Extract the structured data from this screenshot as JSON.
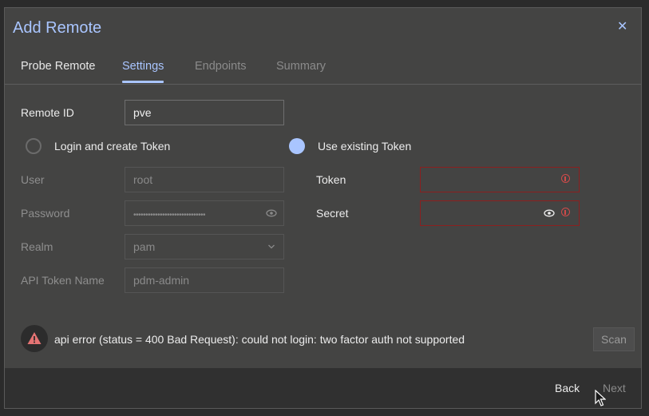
{
  "dialog": {
    "title": "Add Remote",
    "close_icon": "close-icon"
  },
  "tabs": [
    {
      "label": "Probe Remote",
      "state": "enabled"
    },
    {
      "label": "Settings",
      "state": "active"
    },
    {
      "label": "Endpoints",
      "state": "disabled"
    },
    {
      "label": "Summary",
      "state": "disabled"
    }
  ],
  "form": {
    "remote_id": {
      "label": "Remote ID",
      "value": "pve"
    },
    "auth_mode": {
      "options": [
        {
          "label": "Login and create Token",
          "selected": false
        },
        {
          "label": "Use existing Token",
          "selected": true
        }
      ]
    },
    "user": {
      "label": "User",
      "value": "root"
    },
    "password": {
      "label": "Password",
      "value": "••••••••••••••••••••••••••••••"
    },
    "realm": {
      "label": "Realm",
      "value": "pam"
    },
    "api_token_name": {
      "label": "API Token Name",
      "value": "pdm-admin"
    },
    "token": {
      "label": "Token",
      "value": ""
    },
    "secret": {
      "label": "Secret",
      "value": ""
    }
  },
  "error": {
    "message": "api error (status = 400 Bad Request): could not login: two factor auth not supported"
  },
  "buttons": {
    "scan": "Scan",
    "back": "Back",
    "next": "Next"
  },
  "colors": {
    "accent": "#a9c5ff",
    "error": "#d04a4a",
    "background": "#444443",
    "footer": "#303030"
  }
}
